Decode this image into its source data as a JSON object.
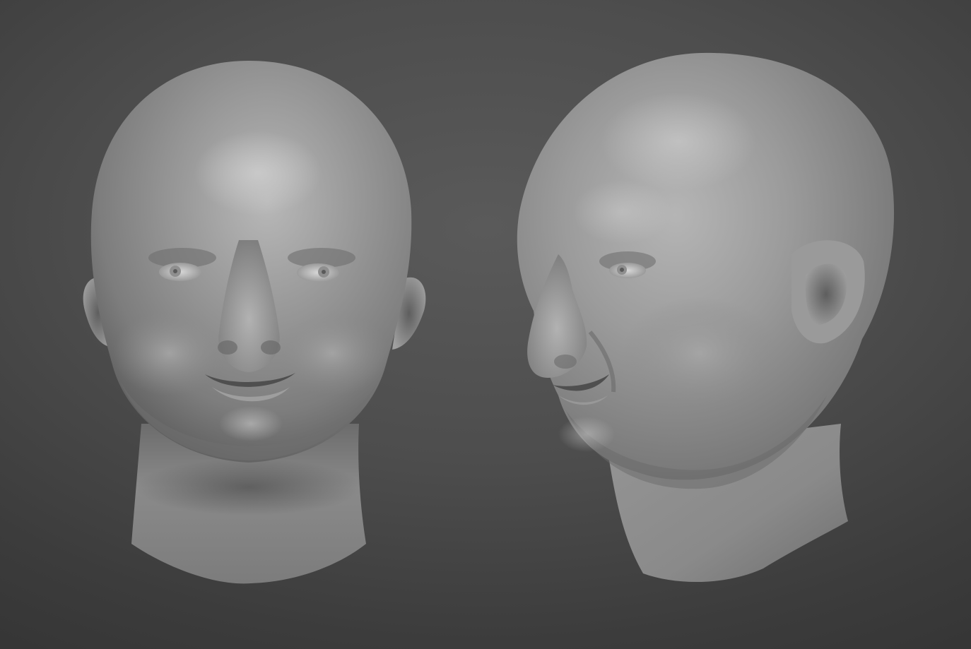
{
  "scene": {
    "background_color": "#4b4b4b",
    "material_color": "#8e8e8e",
    "models": [
      {
        "view": "front",
        "subject": "sculpted-head"
      },
      {
        "view": "three-quarter",
        "subject": "sculpted-head"
      }
    ]
  }
}
